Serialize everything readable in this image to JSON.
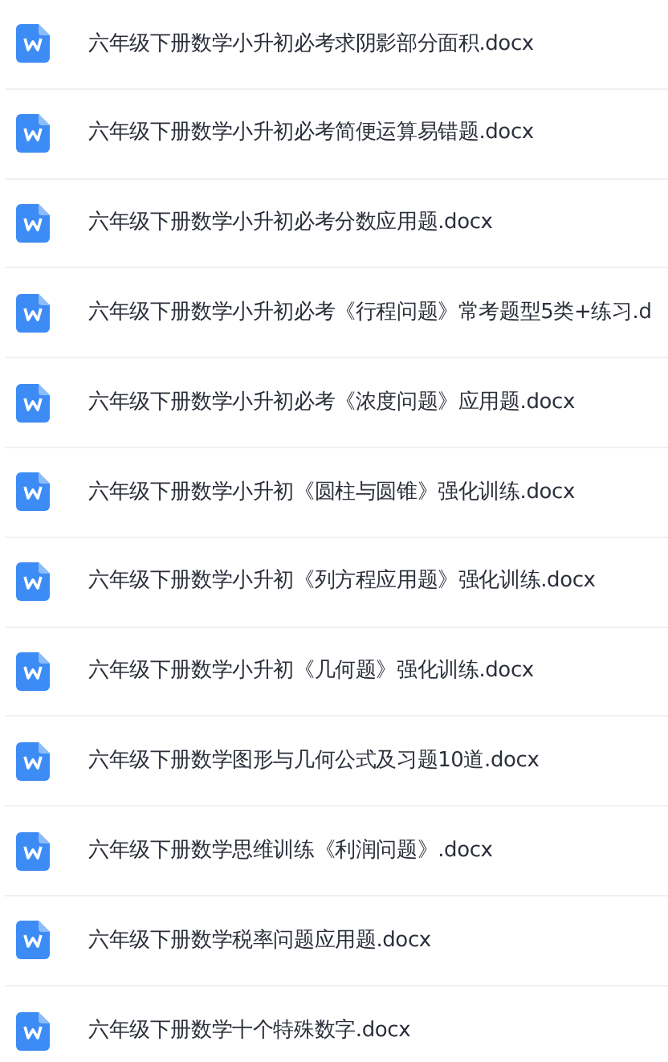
{
  "files": [
    {
      "name": "六年级下册数学小升初必考求阴影部分面积.docx"
    },
    {
      "name": "六年级下册数学小升初必考简便运算易错题.docx"
    },
    {
      "name": "六年级下册数学小升初必考分数应用题.docx"
    },
    {
      "name": "六年级下册数学小升初必考《行程问题》常考题型5类+练习.d"
    },
    {
      "name": "六年级下册数学小升初必考《浓度问题》应用题.docx"
    },
    {
      "name": "六年级下册数学小升初《圆柱与圆锥》强化训练.docx"
    },
    {
      "name": "六年级下册数学小升初《列方程应用题》强化训练.docx"
    },
    {
      "name": "六年级下册数学小升初《几何题》强化训练.docx"
    },
    {
      "name": "六年级下册数学图形与几何公式及习题10道.docx"
    },
    {
      "name": "六年级下册数学思维训练《利润问题》.docx"
    },
    {
      "name": "六年级下册数学税率问题应用题.docx"
    },
    {
      "name": "六年级下册数学十个特殊数字.docx"
    }
  ]
}
